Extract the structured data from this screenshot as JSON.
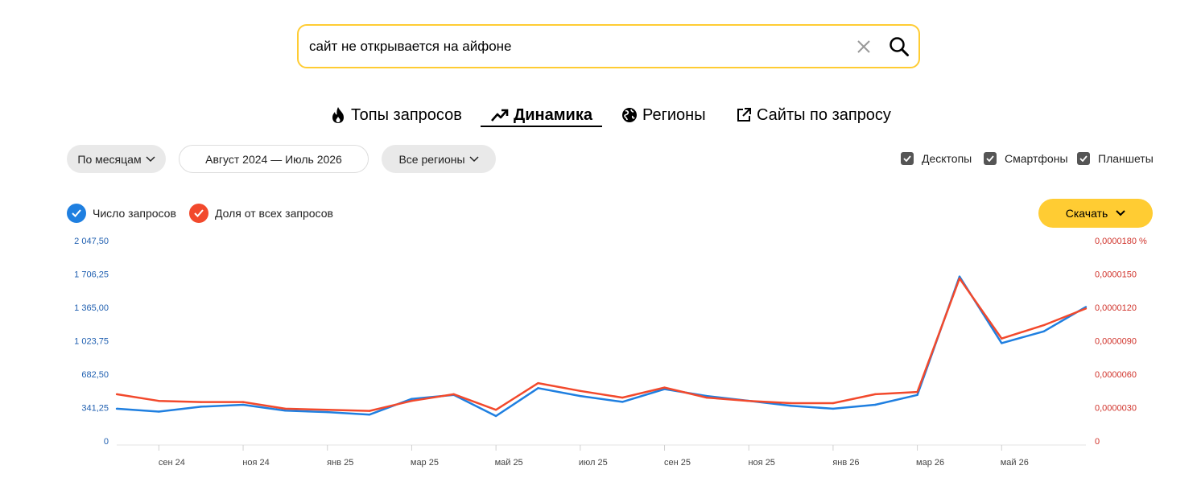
{
  "search": {
    "query": "сайт не открывается на айфоне"
  },
  "tabs": [
    {
      "label": "Топы запросов",
      "icon": "flame-icon"
    },
    {
      "label": "Динамика",
      "icon": "trend-arrow-icon"
    },
    {
      "label": "Регионы",
      "icon": "globe-icon"
    },
    {
      "label": "Сайты по запросу",
      "icon": "external-link-icon"
    }
  ],
  "filters": {
    "period_group": "По месяцам",
    "date_range": "Август 2024 — Июль 2026",
    "region": "Все регионы"
  },
  "devices": [
    {
      "label": "Десктопы",
      "checked": true
    },
    {
      "label": "Смартфоны",
      "checked": true
    },
    {
      "label": "Планшеты",
      "checked": true
    }
  ],
  "legend": [
    {
      "label": "Число запросов",
      "color": "#1f7fe0",
      "checked": true
    },
    {
      "label": "Доля от всех запросов",
      "color": "#f2492c",
      "checked": true
    }
  ],
  "download_label": "Скачать",
  "colors": {
    "accent": "#ffcc33",
    "series_count": "#1f7fe0",
    "series_share": "#f2492c"
  },
  "chart_data": {
    "type": "line",
    "x": [
      "авг 24",
      "сен 24",
      "окт 24",
      "ноя 24",
      "дек 24",
      "янв 25",
      "фев 25",
      "мар 25",
      "апр 25",
      "май 25",
      "июн 25",
      "июл 25",
      "авг 25",
      "сен 25",
      "окт 25",
      "ноя 25",
      "дек 25",
      "янв 26",
      "фев 26",
      "мар 26",
      "апр 26",
      "май 26",
      "июн 26",
      "июл 26"
    ],
    "x_tick_labels": [
      "сен 24",
      "ноя 24",
      "янв 25",
      "мар 25",
      "май 25",
      "июл 25",
      "сен 25",
      "ноя 25",
      "янв 26",
      "мар 26",
      "май 26"
    ],
    "x_tick_indices": [
      1,
      3,
      5,
      7,
      9,
      11,
      13,
      15,
      17,
      19,
      21
    ],
    "y_left": {
      "ticks": [
        "0",
        "341,25",
        "682,50",
        "1 023,75",
        "1 365,00",
        "1 706,25",
        "2 047,50"
      ],
      "ylim": [
        0,
        2047.5
      ],
      "color": "#1f5fb0"
    },
    "y_right": {
      "ticks": [
        "0",
        "0,0000030",
        "0,0000060",
        "0,0000090",
        "0,0000120",
        "0,0000150",
        "0,0000180 %"
      ],
      "ylim": [
        0,
        1.8e-05
      ],
      "color": "#d0322a"
    },
    "series": [
      {
        "name": "Число запросов",
        "axis": "left",
        "color": "#1f7fe0",
        "values": [
          330,
          300,
          350,
          370,
          310,
          295,
          270,
          430,
          470,
          255,
          540,
          460,
          400,
          530,
          460,
          410,
          360,
          330,
          370,
          470,
          1680,
          1000,
          1120,
          1370
        ]
      },
      {
        "name": "Доля от всех запросов",
        "axis": "right",
        "color": "#f2492c",
        "values": [
          4.2e-06,
          3.6e-06,
          3.5e-06,
          3.5e-06,
          2.9e-06,
          2.8e-06,
          2.7e-06,
          3.6e-06,
          4.2e-06,
          2.8e-06,
          5.2e-06,
          4.5e-06,
          3.9e-06,
          4.8e-06,
          3.9e-06,
          3.6e-06,
          3.4e-06,
          3.4e-06,
          4.2e-06,
          4.4e-06,
          1.46e-05,
          9.2e-06,
          1.04e-05,
          1.19e-05
        ]
      }
    ],
    "grid": false
  }
}
